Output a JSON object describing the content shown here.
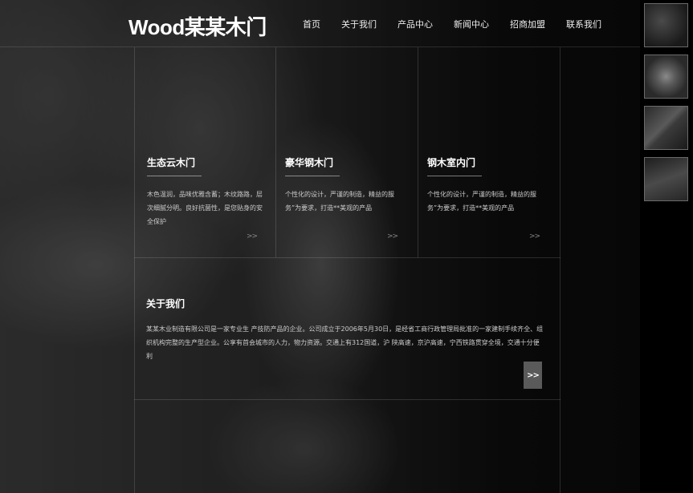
{
  "header": {
    "logo": "Wood某某木门",
    "nav": [
      "首页",
      "关于我们",
      "产品中心",
      "新闻中心",
      "招商加盟",
      "联系我们"
    ]
  },
  "products": [
    {
      "title": "生态云木门",
      "desc": "木色温润，品味优雅含蓄；木纹路路，层次细腻分明。良好抗菌性，是您贴身的安全保护",
      "more": ">>"
    },
    {
      "title": "豪华钢木门",
      "desc": "个性化的设计，严谨的制造，精益的服务”为要求，打造**美观的产品",
      "more": ">>"
    },
    {
      "title": "钢木室内门",
      "desc": "个性化的设计，严谨的制造，精益的服务”为要求，打造**美观的产品",
      "more": ">>"
    }
  ],
  "about": {
    "title": "关于我们",
    "text": "某某木业制造有限公司是一家专业生 产技防产品的企业。公司成立于2006年5月30日，是经省工商行政管理局批准的一家建制手续齐全、组织机构完整的生产型企业。公享有首会城市的人力，物力资源。交通上有312国道，沪 陕高速，京沪高速，宁西铁路贯穿全境，交通十分便利",
    "more": ">>"
  },
  "thumbnails": [
    "thumbnail-1",
    "thumbnail-2",
    "thumbnail-3",
    "thumbnail-4"
  ]
}
